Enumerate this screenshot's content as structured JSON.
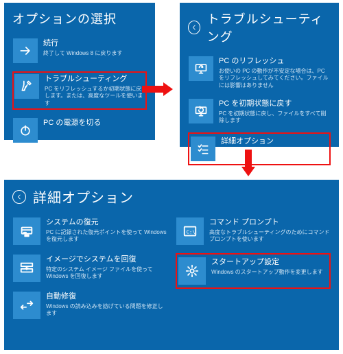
{
  "panel1": {
    "title": "オプションの選択",
    "items": [
      {
        "title": "続行",
        "desc": "終了して Windows 8 に戻ります"
      },
      {
        "title": "トラブルシューティング",
        "desc": "PC をリフレッシュするか初期状態に戻します。または、高度なツールを使います"
      },
      {
        "title": "PC の電源を切る",
        "desc": ""
      }
    ]
  },
  "panel2": {
    "title": "トラブルシューティング",
    "items": [
      {
        "title": "PC のリフレッシュ",
        "desc": "お使いの PC の動作が不安定な場合は、PC をリフレッシュしてみてください。ファイルには影響はありません"
      },
      {
        "title": "PC を初期状態に戻す",
        "desc": "PC を初期状態に戻し、ファイルをすべて削除します"
      },
      {
        "title": "詳細オプション",
        "desc": ""
      }
    ]
  },
  "panel3": {
    "title": "詳細オプション",
    "left": [
      {
        "title": "システムの復元",
        "desc": "PC に記録された復元ポイントを使って Windows を復元します"
      },
      {
        "title": "イメージでシステムを回復",
        "desc": "特定のシステム イメージ ファイルを使って Windows を回復します"
      },
      {
        "title": "自動修復",
        "desc": "Windows の読み込みを妨げている問題を修正します"
      }
    ],
    "right": [
      {
        "title": "コマンド プロンプト",
        "desc": "高度なトラブルシューティングのためにコマンド プロンプトを使います"
      },
      {
        "title": "スタートアップ設定",
        "desc": "Windows のスタートアップ動作を変更します"
      }
    ]
  }
}
